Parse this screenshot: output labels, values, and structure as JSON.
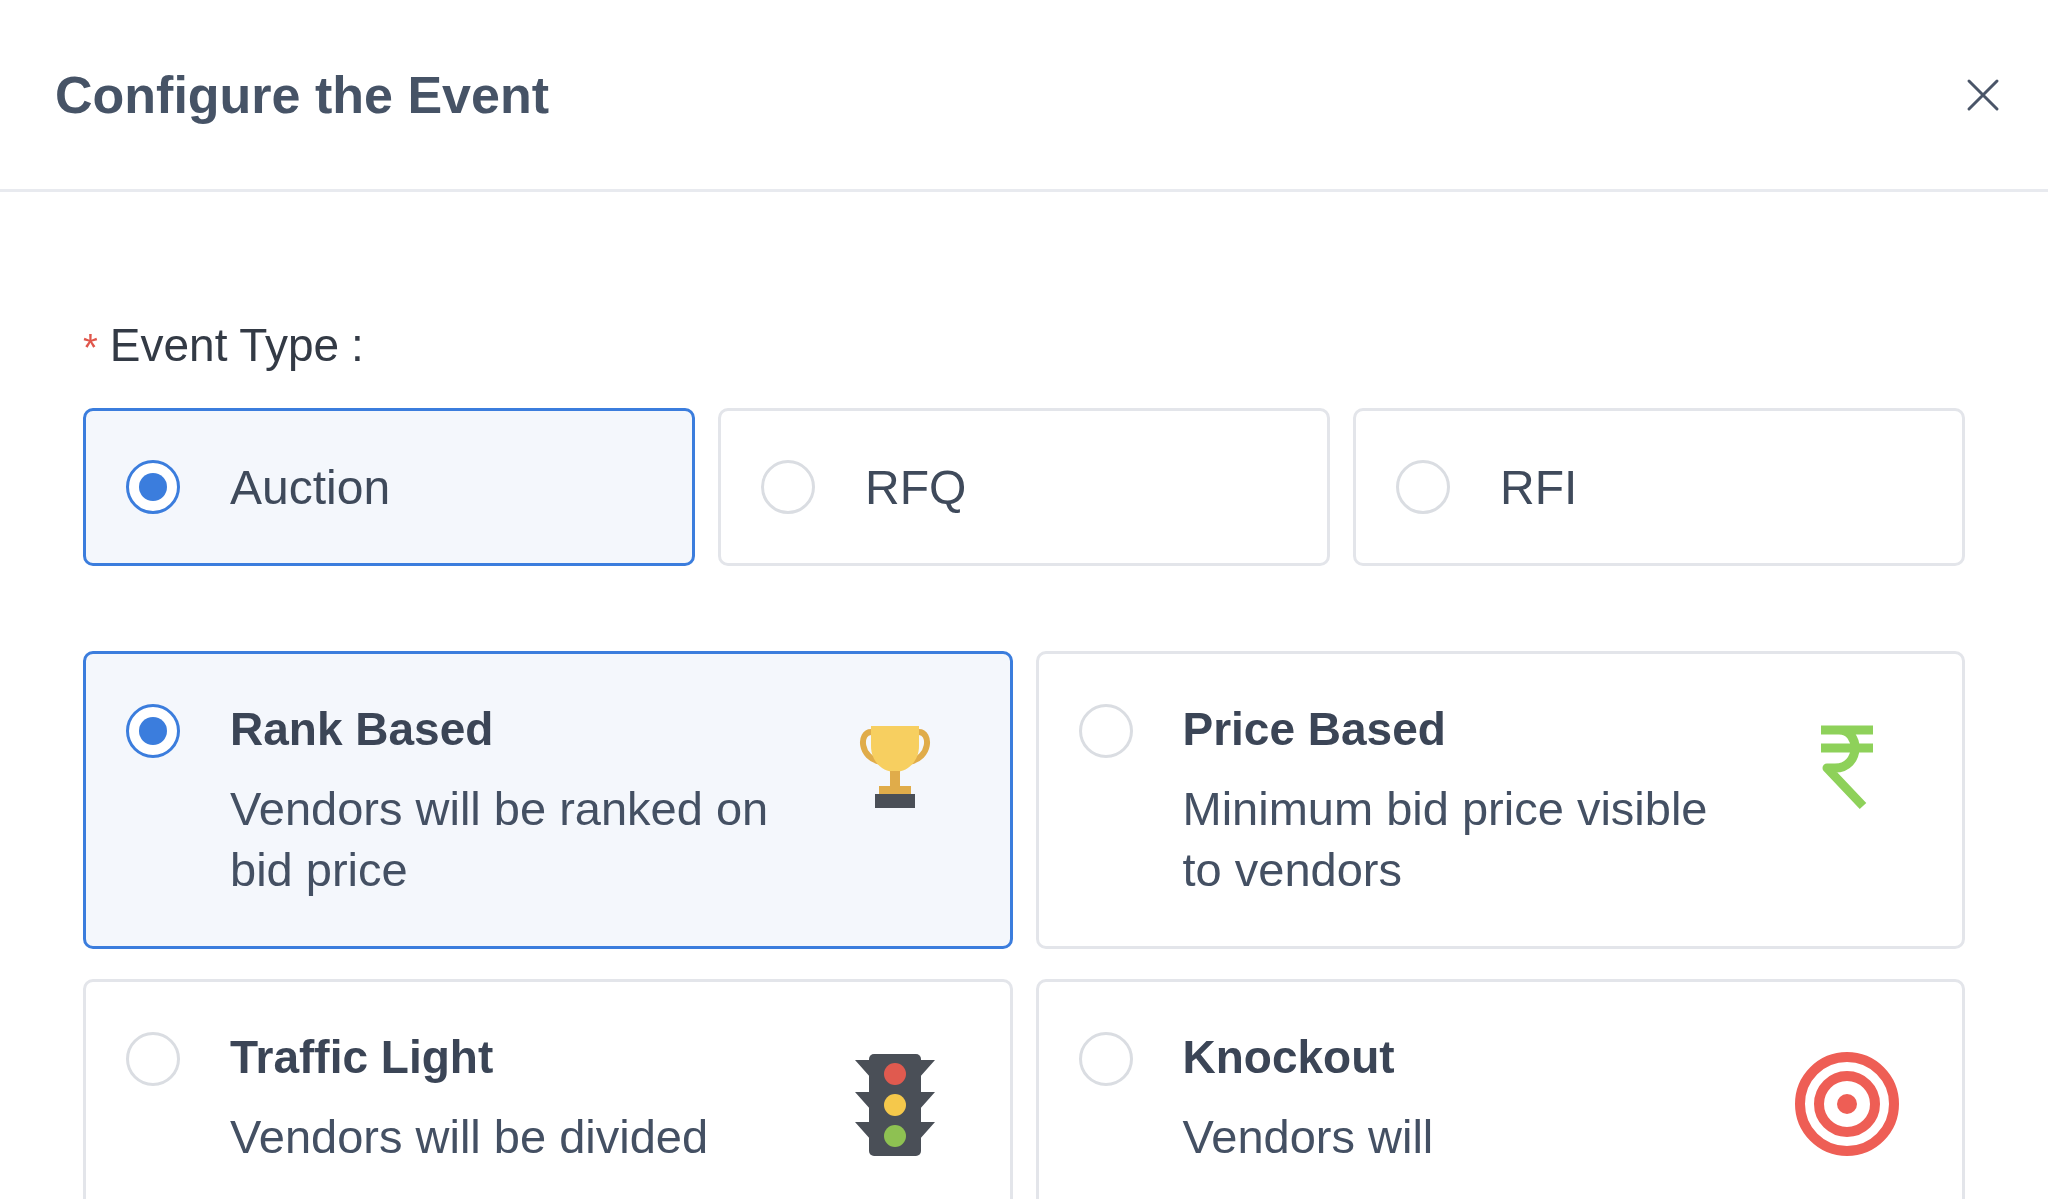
{
  "dialog": {
    "title": "Configure the Event"
  },
  "event_type": {
    "label": "Event Type",
    "required_mark": "*",
    "colon": ":",
    "options": [
      {
        "label": "Auction",
        "selected": true
      },
      {
        "label": "RFQ",
        "selected": false
      },
      {
        "label": "RFI",
        "selected": false
      }
    ]
  },
  "modes": [
    {
      "title": "Rank Based",
      "description": "Vendors will be ranked on bid price",
      "selected": true
    },
    {
      "title": "Price Based",
      "description": "Minimum bid price visible to vendors",
      "selected": false
    },
    {
      "title": "Traffic Light",
      "description": "Vendors will be divided",
      "selected": false
    },
    {
      "title": "Knockout",
      "description": "Vendors will",
      "selected": false
    }
  ]
}
